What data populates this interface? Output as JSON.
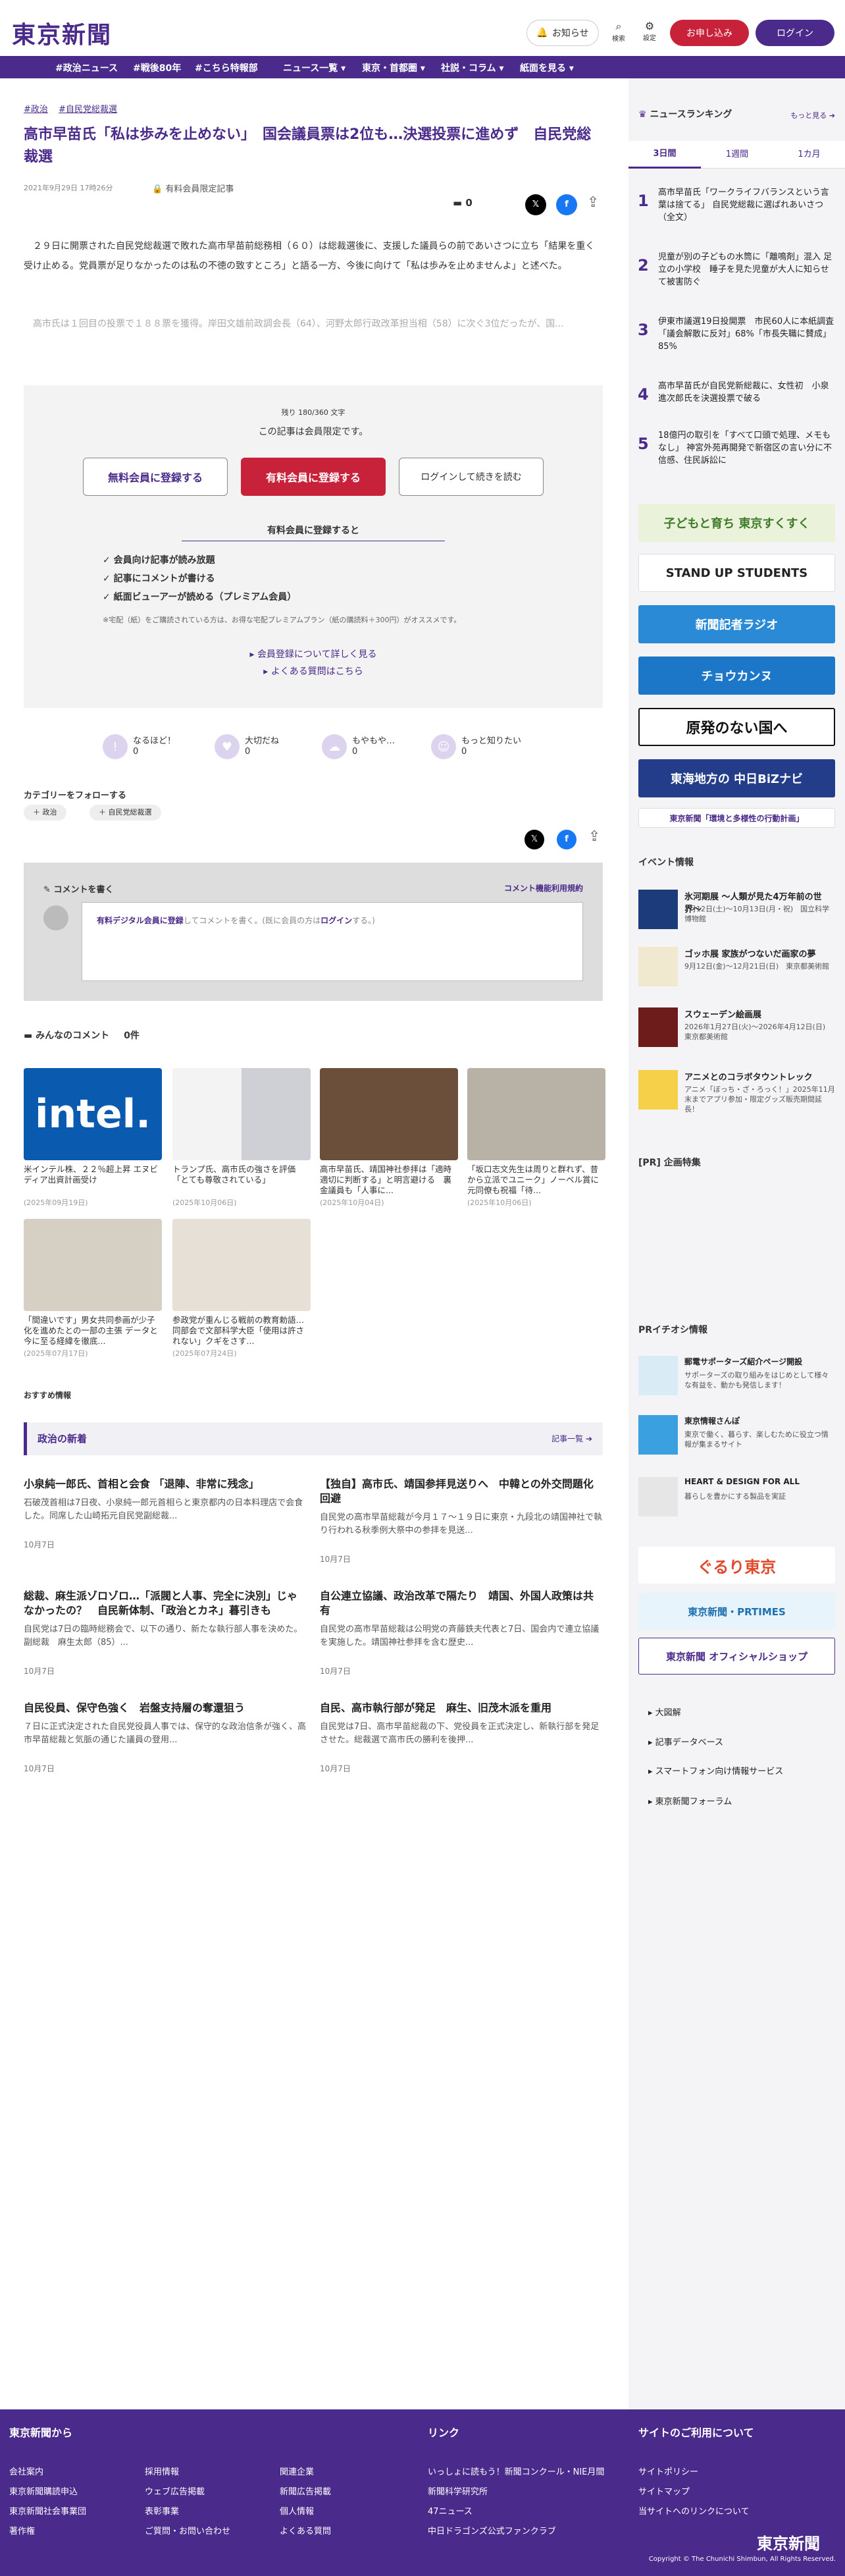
{
  "header": {
    "logo": "東京新聞",
    "notice": "お知らせ",
    "search": "検索",
    "settings": "設定",
    "apply": "お申し込み",
    "login": "ログイン"
  },
  "nav": [
    "#政治ニュース",
    "#戦後80年",
    "#こちら特報部",
    "ニュース一覧 ▾",
    "東京・首都圏 ▾",
    "社説・コラム ▾",
    "紙面を見る ▾"
  ],
  "article": {
    "tags": [
      "#政治",
      "#自民党総裁選"
    ],
    "title": "高市早苗氏「私は歩みを止めない」　国会議員票は2位も…決選投票に進めず　自民党総裁選",
    "date": "2021年9月29日 17時26分",
    "paid": "有料会員限定記事",
    "comments": "0",
    "p1": "２９日に開票された自民党総裁選で敗れた高市早苗前総務相（６０）は総裁選後に、支援した議員らの前であいさつに立ち「結果を重く受け止める。党員票が足りなかったのは私の不徳の致すところ」と語る一方、今後に向けて「私は歩みを止めませんよ」と述べた。",
    "p2": "高市氏は１回目の投票で１８８票を獲得。岸田文雄前政調会長（64）、河野太郎行政改革担当相（58）に次ぐ3位だったが、国..."
  },
  "paywall": {
    "remaining": "残り 180/360 文字",
    "limited": "この記事は会員限定です。",
    "free": "無料会員に登録する",
    "paid": "有料会員に登録する",
    "login": "ログインして続きを読む",
    "heading": "有料会員に登録すると",
    "benefits": [
      "✓ 会員向け記事が読み放題",
      "✓ 記事にコメントが書ける",
      "✓ 紙面ビューアーが読める（プレミアム会員）"
    ],
    "note": "※宅配（紙）をご購読されている方は、お得な宅配プレミアムプラン（紙の購読料＋300円）がオススメです。",
    "more": "会員登録について詳しく見る",
    "faq": "よくある質問はこちら"
  },
  "reactions": [
    {
      "label": "なるほど！",
      "count": "0"
    },
    {
      "label": "大切だね",
      "count": "0"
    },
    {
      "label": "もやもや…",
      "count": "0"
    },
    {
      "label": "もっと知りたい",
      "count": "0"
    }
  ],
  "category": {
    "heading": "カテゴリーをフォローする",
    "items": [
      "政治",
      "自民党総裁選"
    ]
  },
  "comment": {
    "heading": "コメントを書く",
    "rules": "コメント機能利用規約",
    "prompt_link": "有料デジタル会員に登録",
    "prompt_rest": "してコメントを書く。(既に会員の方は",
    "login": "ログイン",
    "end": "する。)"
  },
  "everyone": {
    "heading": "みんなのコメント",
    "count": "0件"
  },
  "thumbs": [
    {
      "cap": "米インテル株、２２％超上昇 エヌビディア出資計画受け",
      "date": "(2025年09月19日)",
      "color": "#0a5bb0"
    },
    {
      "cap": "トランプ氏、高市氏の強さを評価「とても尊敬されている」",
      "date": "(2025年10月06日)",
      "color": "#c9cdd6"
    },
    {
      "cap": "高市早苗氏、靖国神社参拝は「適時適切に判断する」と明言避ける　裏金議員も「人事に...",
      "date": "(2025年10月04日)",
      "color": "#6b4f3a"
    },
    {
      "cap": "「坂口志文先生は周りと群れず、昔から立派でユニーク」ノーベル賞に元同僚も祝福「待...",
      "date": "(2025年10月06日)",
      "color": "#b8b2a6"
    },
    {
      "cap": "「間違いです」男女共同参画が少子化を進めたとの一部の主張 データと今に至る経緯を徹底...",
      "date": "(2025年07月17日)",
      "color": "#d6cfc4"
    },
    {
      "cap": "参政党が重んじる戦前の教育勅語…同部会で文部科学大臣「使用は許されない」クギをさす...",
      "date": "(2025年07月24日)",
      "color": "#e6e0d6"
    }
  ],
  "recommend": "おすすめ情報",
  "politics": {
    "heading": "政治の新着",
    "more": "記事一覧",
    "items": [
      {
        "title": "小泉純一郎氏、首相と会食 「退陣、非常に残念」",
        "body": "石破茂首相は7日夜、小泉純一郎元首相らと東京都内の日本料理店で会食した。同席した山崎拓元自民党副総裁...",
        "date": "10月7日"
      },
      {
        "title": "【独自】高市氏、靖国参拝見送りへ　中韓との外交問題化回避",
        "body": "自民党の高市早苗総裁が今月１７〜１９日に東京・九段北の靖国神社で執り行われる秋季例大祭中の参拝を見送...",
        "date": "10月7日"
      },
      {
        "title": "総裁、麻生派ゾロゾロ…「派閥と人事、完全に決別」じゃなかったの？　自民新体制、「政治とカネ」暮引きも",
        "body": "自民党は7日の臨時総務会で、以下の通り、新たな執行部人事を決めた。副総裁　麻生太郎（85）...",
        "date": "10月7日"
      },
      {
        "title": "自公連立協議、政治改革で隔たり　靖国、外国人政策は共有",
        "body": "自民党の高市早苗総裁は公明党の斉藤鉄夫代表と7日、国会内で連立協議を実施した。靖国神社参拝を含む歴史...",
        "date": "10月7日"
      },
      {
        "title": "自民役員、保守色強く　岩盤支持層の奪還狙う",
        "body": "７日に正式決定された自民党役員人事では、保守的な政治信条が強く、高市早苗総裁と気脈の通じた議員の登用...",
        "date": "10月7日"
      },
      {
        "title": "自民、高市執行部が発足　麻生、旧茂木派を重用",
        "body": "自民党は7日、高市早苗総裁の下、党役員を正式決定し、新執行部を発足させた。総裁選で高市氏の勝利を後押...",
        "date": "10月7日"
      }
    ]
  },
  "ranking": {
    "heading": "ニュースランキング",
    "more": "もっと見る",
    "tabs": [
      "3日間",
      "1週間",
      "1カ月"
    ],
    "items": [
      "高市早苗氏「ワークライフバランスという言葉は捨てる」 自民党総裁に選ばれあいさつ（全文）",
      "児童が別の子どもの水筒に「離鳴剤」混入 足立の小学校　睡子を見た児童が大人に知らせて被害防ぐ",
      "伊東市議選19日投開票　市民60人に本紙調査「議会解散に反対」68%「市長失職に賛成」85%",
      "高市早苗氏が自民党新総裁に、女性初　小泉進次郎氏を決選投票で破る",
      "18億円の取引を「すべて口頭で処理、メモもなし」 神宮外苑再開発で新宿区の言い分に不信感、住民訴訟に"
    ]
  },
  "banners": [
    {
      "text": "子どもと育ち 東京すくすく",
      "bg": "#eaf3da",
      "fg": "#3d7a2a"
    },
    {
      "text": "STAND UP STUDENTS",
      "bg": "#ffffff",
      "fg": "#222"
    },
    {
      "text": "新聞記者ラジオ",
      "bg": "#2a8ad6",
      "fg": "#fff"
    },
    {
      "text": "チョウカンヌ",
      "bg": "#1d77c9",
      "fg": "#fff"
    },
    {
      "text": "原発のない国へ",
      "bg": "#ffffff",
      "fg": "#111"
    },
    {
      "text": "東海地方の 中日BiZナビ",
      "bg": "#233d8a",
      "fg": "#fff"
    },
    {
      "text": "東京新聞「環境と多様性の行動計画」",
      "bg": "#ffffff",
      "fg": "#4a2a8a"
    }
  ],
  "events": {
    "heading": "イベント情報",
    "items": [
      {
        "title": "氷河期展 〜人類が見た4万年前の世界〜",
        "desc": "7月12日(土)〜10月13日(月・祝)　国立科学博物館",
        "color": "#1b3b7a"
      },
      {
        "title": "ゴッホ展 家族がつないだ画家の夢",
        "desc": "9月12日(金)〜12月21日(日)　東京都美術館",
        "color": "#f1e8d0"
      },
      {
        "title": "スウェーデン絵画展",
        "desc": "2026年1月27日(火)〜2026年4月12日(日)　東京都美術館",
        "color": "#6d1b1b"
      },
      {
        "title": "アニメとのコラボタウントレック",
        "desc": "アニメ「ぼっち・ざ・ろっく！」2025年11月末までアプリ参加・限定グッズ販売期間延長！",
        "color": "#f7d04a"
      }
    ]
  },
  "pr": {
    "heading": "[PR] 企画特集",
    "heading2": "PRイチオシ情報",
    "items": [
      {
        "title": "郵電サポーターズ紹介ページ開設",
        "desc": "サポーターズの取り組みをはじめとして様々な有益を、動かも発信します！"
      },
      {
        "title": "東京情報さんぽ",
        "desc": "東京で働く、暮らす、楽しむために役立つ情報が集まるサイト"
      },
      {
        "title": "HEART & DESIGN FOR ALL",
        "desc": "暮らしを豊かにする製品を実証"
      }
    ]
  },
  "bottom_banners": [
    "ぐるり東京",
    "東京新聞・PRTIMES",
    "東京新聞 オフィシャルショップ"
  ],
  "side_links": [
    "大図解",
    "記事データベース",
    "スマートフォン向け情報サービス",
    "東京新聞フォーラム"
  ],
  "footer": {
    "col1": "東京新聞から",
    "col2": "リンク",
    "col3": "サイトのご利用について",
    "c1": [
      "会社案内",
      "東京新聞購読申込",
      "東京新聞社会事業団",
      "著作権"
    ],
    "c2": [
      "採用情報",
      "ウェブ広告掲載",
      "表彰事業",
      "ご質問・お問い合わせ"
    ],
    "c3": [
      "関連企業",
      "新聞広告掲載",
      "個人情報",
      "よくある質問"
    ],
    "c4": [
      "いっしょに読もう！新聞コンクール・NIE月間",
      "新聞科学研究所",
      "47ニュース",
      "中日ドラゴンズ公式ファンクラブ"
    ],
    "c5": [
      "サイトポリシー",
      "サイトマップ",
      "当サイトへのリンクについて"
    ],
    "logo": "東京新聞",
    "copyright": "Copyright © The Chunichi Shimbun, All Rights Reserved."
  }
}
